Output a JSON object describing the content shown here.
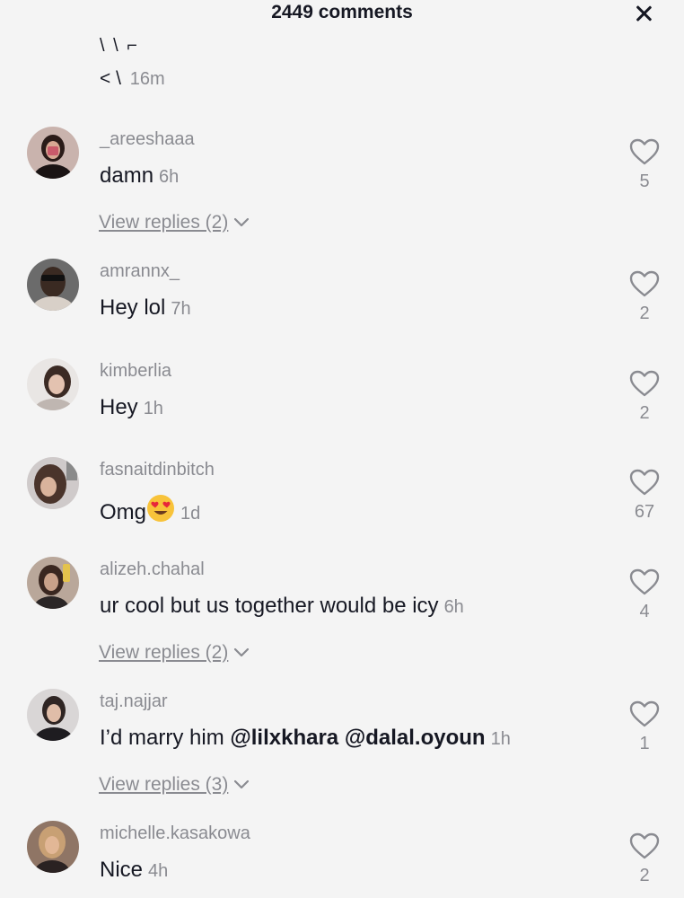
{
  "header": {
    "title": "2449 comments"
  },
  "partial_comment": {
    "fragment": "\\ \\ ⌐",
    "text": "< \\",
    "time": "16m"
  },
  "comments": [
    {
      "username": "_areeshaaa",
      "text": "damn",
      "time": "6h",
      "likes": "5",
      "replies": "View replies (2)"
    },
    {
      "username": "amrannx_",
      "text": "Hey lol",
      "time": "7h",
      "likes": "2"
    },
    {
      "username": "kimberlia",
      "text": "Hey",
      "time": "1h",
      "likes": "2"
    },
    {
      "username": "fasnaitdinbitch",
      "text": "Omg",
      "emoji": "heart-eyes-emoji",
      "time": "1d",
      "likes": "67"
    },
    {
      "username": "alizeh.chahal",
      "text": "ur cool but us together would be icy",
      "time": "6h",
      "likes": "4",
      "replies": "View replies (2)"
    },
    {
      "username": "taj.najjar",
      "text": "I’d marry him",
      "mention1": "@lilxkhara",
      "mention2": "@dalal.oyoun",
      "time": "1h",
      "likes": "1",
      "replies": "View replies (3)"
    },
    {
      "username": "michelle.kasakowa",
      "text": "Nice",
      "time": "4h",
      "likes": "2"
    }
  ],
  "colors": {
    "background": "#f4f4f4",
    "primary_text": "#161823",
    "secondary_text": "#8a8b91"
  },
  "icons": {
    "close": "close-icon",
    "like": "heart-outline-icon",
    "expand": "chevron-down-icon"
  }
}
